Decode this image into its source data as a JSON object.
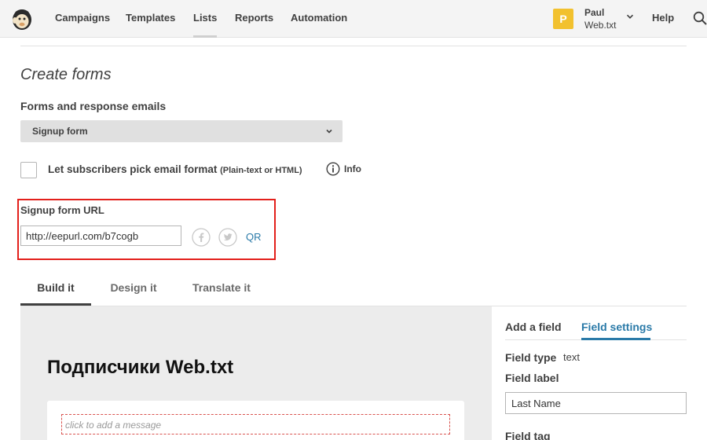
{
  "nav": {
    "items": [
      {
        "label": "Campaigns"
      },
      {
        "label": "Templates"
      },
      {
        "label": "Lists"
      },
      {
        "label": "Reports"
      },
      {
        "label": "Automation"
      }
    ],
    "active": "Lists",
    "user": {
      "initial": "P",
      "name": "Paul",
      "org": "Web.txt"
    },
    "help": "Help",
    "icons": [
      "mailchimp-logo",
      "chevron-down-icon",
      "search-icon"
    ],
    "avatar_color": "#f2c12e"
  },
  "page": {
    "title": "Create forms",
    "forms_label": "Forms and response emails",
    "form_select": {
      "value": "Signup form"
    },
    "email_format": {
      "label": "Let subscribers pick email format",
      "hint": "(Plain-text or HTML)",
      "checked": false,
      "info": "Info"
    },
    "signup_url": {
      "label": "Signup form URL",
      "value": "http://eepurl.com/b7cogb",
      "qr": "QR",
      "highlight_color": "#e3201b"
    }
  },
  "tabs": [
    {
      "label": "Build it",
      "active": true
    },
    {
      "label": "Design it",
      "active": false
    },
    {
      "label": "Translate it",
      "active": false
    }
  ],
  "preview": {
    "title": "Подписчики Web.txt",
    "message_placeholder": "click to add a message"
  },
  "panel": {
    "tabs": [
      {
        "label": "Add a field",
        "active": false
      },
      {
        "label": "Field settings",
        "active": true
      }
    ],
    "field_type_label": "Field type",
    "field_type_value": "text",
    "field_label_label": "Field label",
    "field_label_value": "Last Name",
    "field_tag_label": "Field tag",
    "accent": "#2a7aa8"
  }
}
